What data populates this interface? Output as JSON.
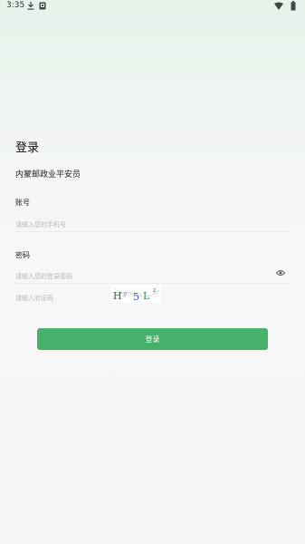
{
  "status_bar": {
    "time": "3:35",
    "icons": [
      "download-icon",
      "sd-card-icon",
      "wifi-icon",
      "battery-icon"
    ]
  },
  "login": {
    "title": "登录",
    "org_name": "内蒙邮政业平安员",
    "account_label": "账号",
    "phone_placeholder": "请输入您的手机号",
    "password_label": "密码",
    "password_placeholder": "请输入您的登录密码",
    "code_placeholder": "请输入验证码",
    "captcha_text": "H5Lz",
    "submit_label": "登录"
  },
  "colors": {
    "accent": "#47b16c",
    "background": "#f6f6f6"
  }
}
